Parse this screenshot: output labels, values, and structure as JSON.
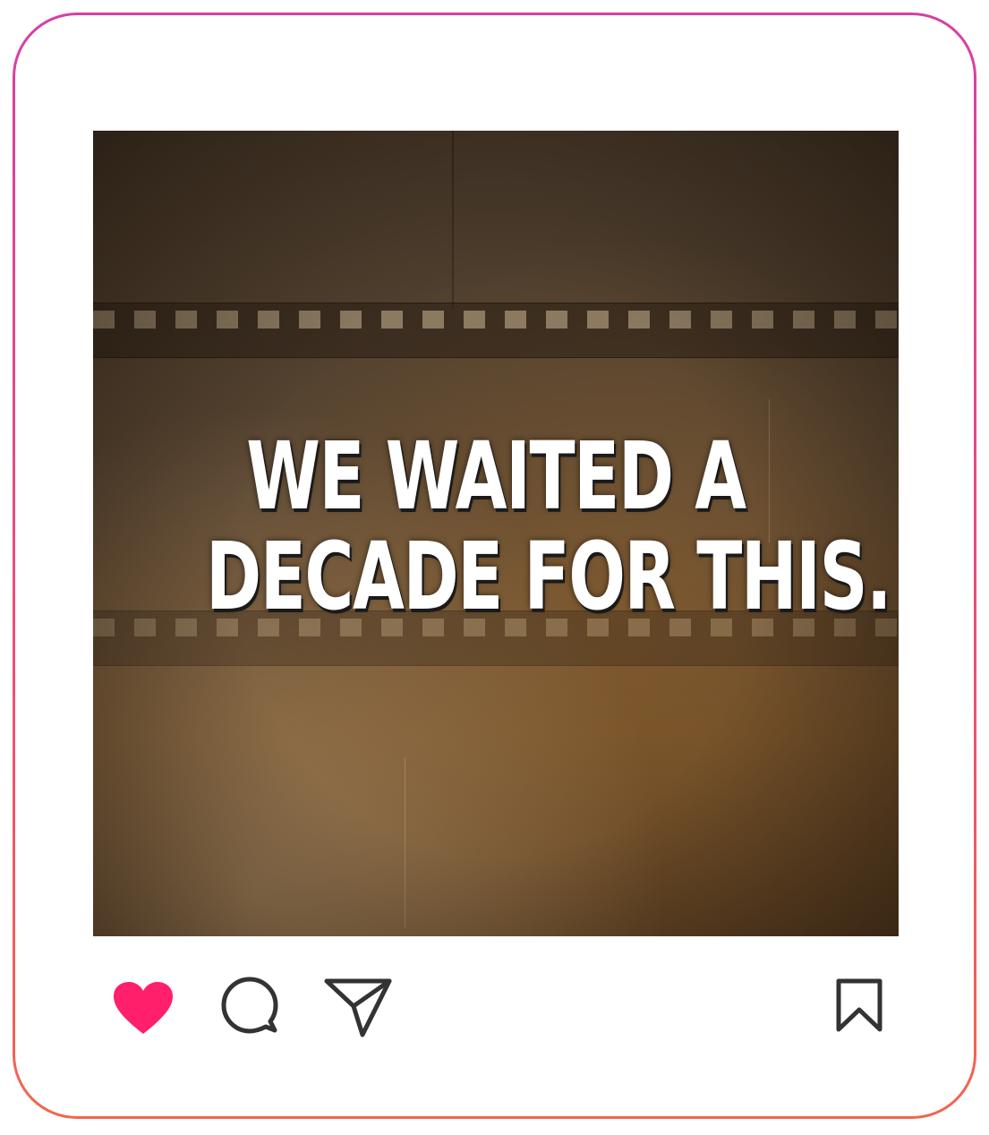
{
  "post": {
    "headline_line1": "WE WAITED A",
    "headline_line2": "DECADE FOR THIS."
  },
  "actions": {
    "like": {
      "icon": "heart-icon",
      "liked": true,
      "color": "#ff1f6b"
    },
    "comment": {
      "icon": "speech-bubble-icon",
      "color": "#333333"
    },
    "share": {
      "icon": "paper-plane-icon",
      "color": "#333333"
    },
    "save": {
      "icon": "bookmark-icon",
      "color": "#333333"
    }
  },
  "colors": {
    "frame_gradient_start": "#d63fa6",
    "frame_gradient_end": "#f2664d",
    "background": "#ffffff"
  }
}
